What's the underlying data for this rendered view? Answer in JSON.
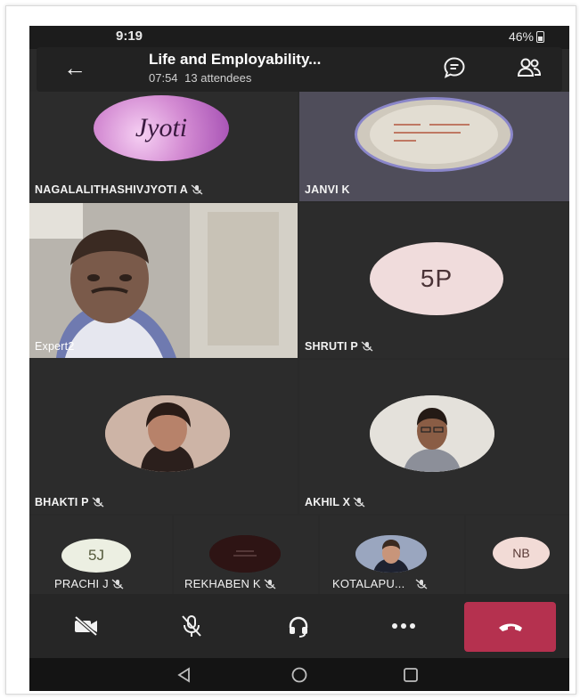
{
  "status_bar": {
    "time": "9:19",
    "battery": "46%"
  },
  "meeting": {
    "title": "Life and Employability...",
    "duration": "07:54",
    "attendees": "13 attendees"
  },
  "tiles": [
    {
      "name": "NAGALALITHASHIVJYOTI A",
      "avatar_text": "Jyoti",
      "muted": true
    },
    {
      "name": "JANVI K",
      "avatar_text": "",
      "muted": false
    },
    {
      "name": "Expert2",
      "avatar_text": "",
      "muted": false
    },
    {
      "name": "SHRUTI P",
      "avatar_text": "5P",
      "muted": true
    },
    {
      "name": "BHAKTI P",
      "avatar_text": "",
      "muted": true
    },
    {
      "name": "AKHIL X",
      "avatar_text": "",
      "muted": true
    }
  ],
  "strip": [
    {
      "name": "PRACHI J",
      "avatar_text": "5J",
      "muted": true
    },
    {
      "name": "REKHABEN K",
      "avatar_text": "",
      "muted": true
    },
    {
      "name": "KOTALAPU...",
      "avatar_text": "",
      "muted": true
    },
    {
      "name": "",
      "avatar_text": "NB",
      "muted": false
    }
  ],
  "controls": {
    "camera": "video-off-icon",
    "mic": "mic-off-icon",
    "audio": "headset-icon",
    "more": "more-icon",
    "hangup": "hang-up-icon"
  },
  "colors": {
    "hangup": "#b5314f",
    "background": "#2a2a2a"
  }
}
